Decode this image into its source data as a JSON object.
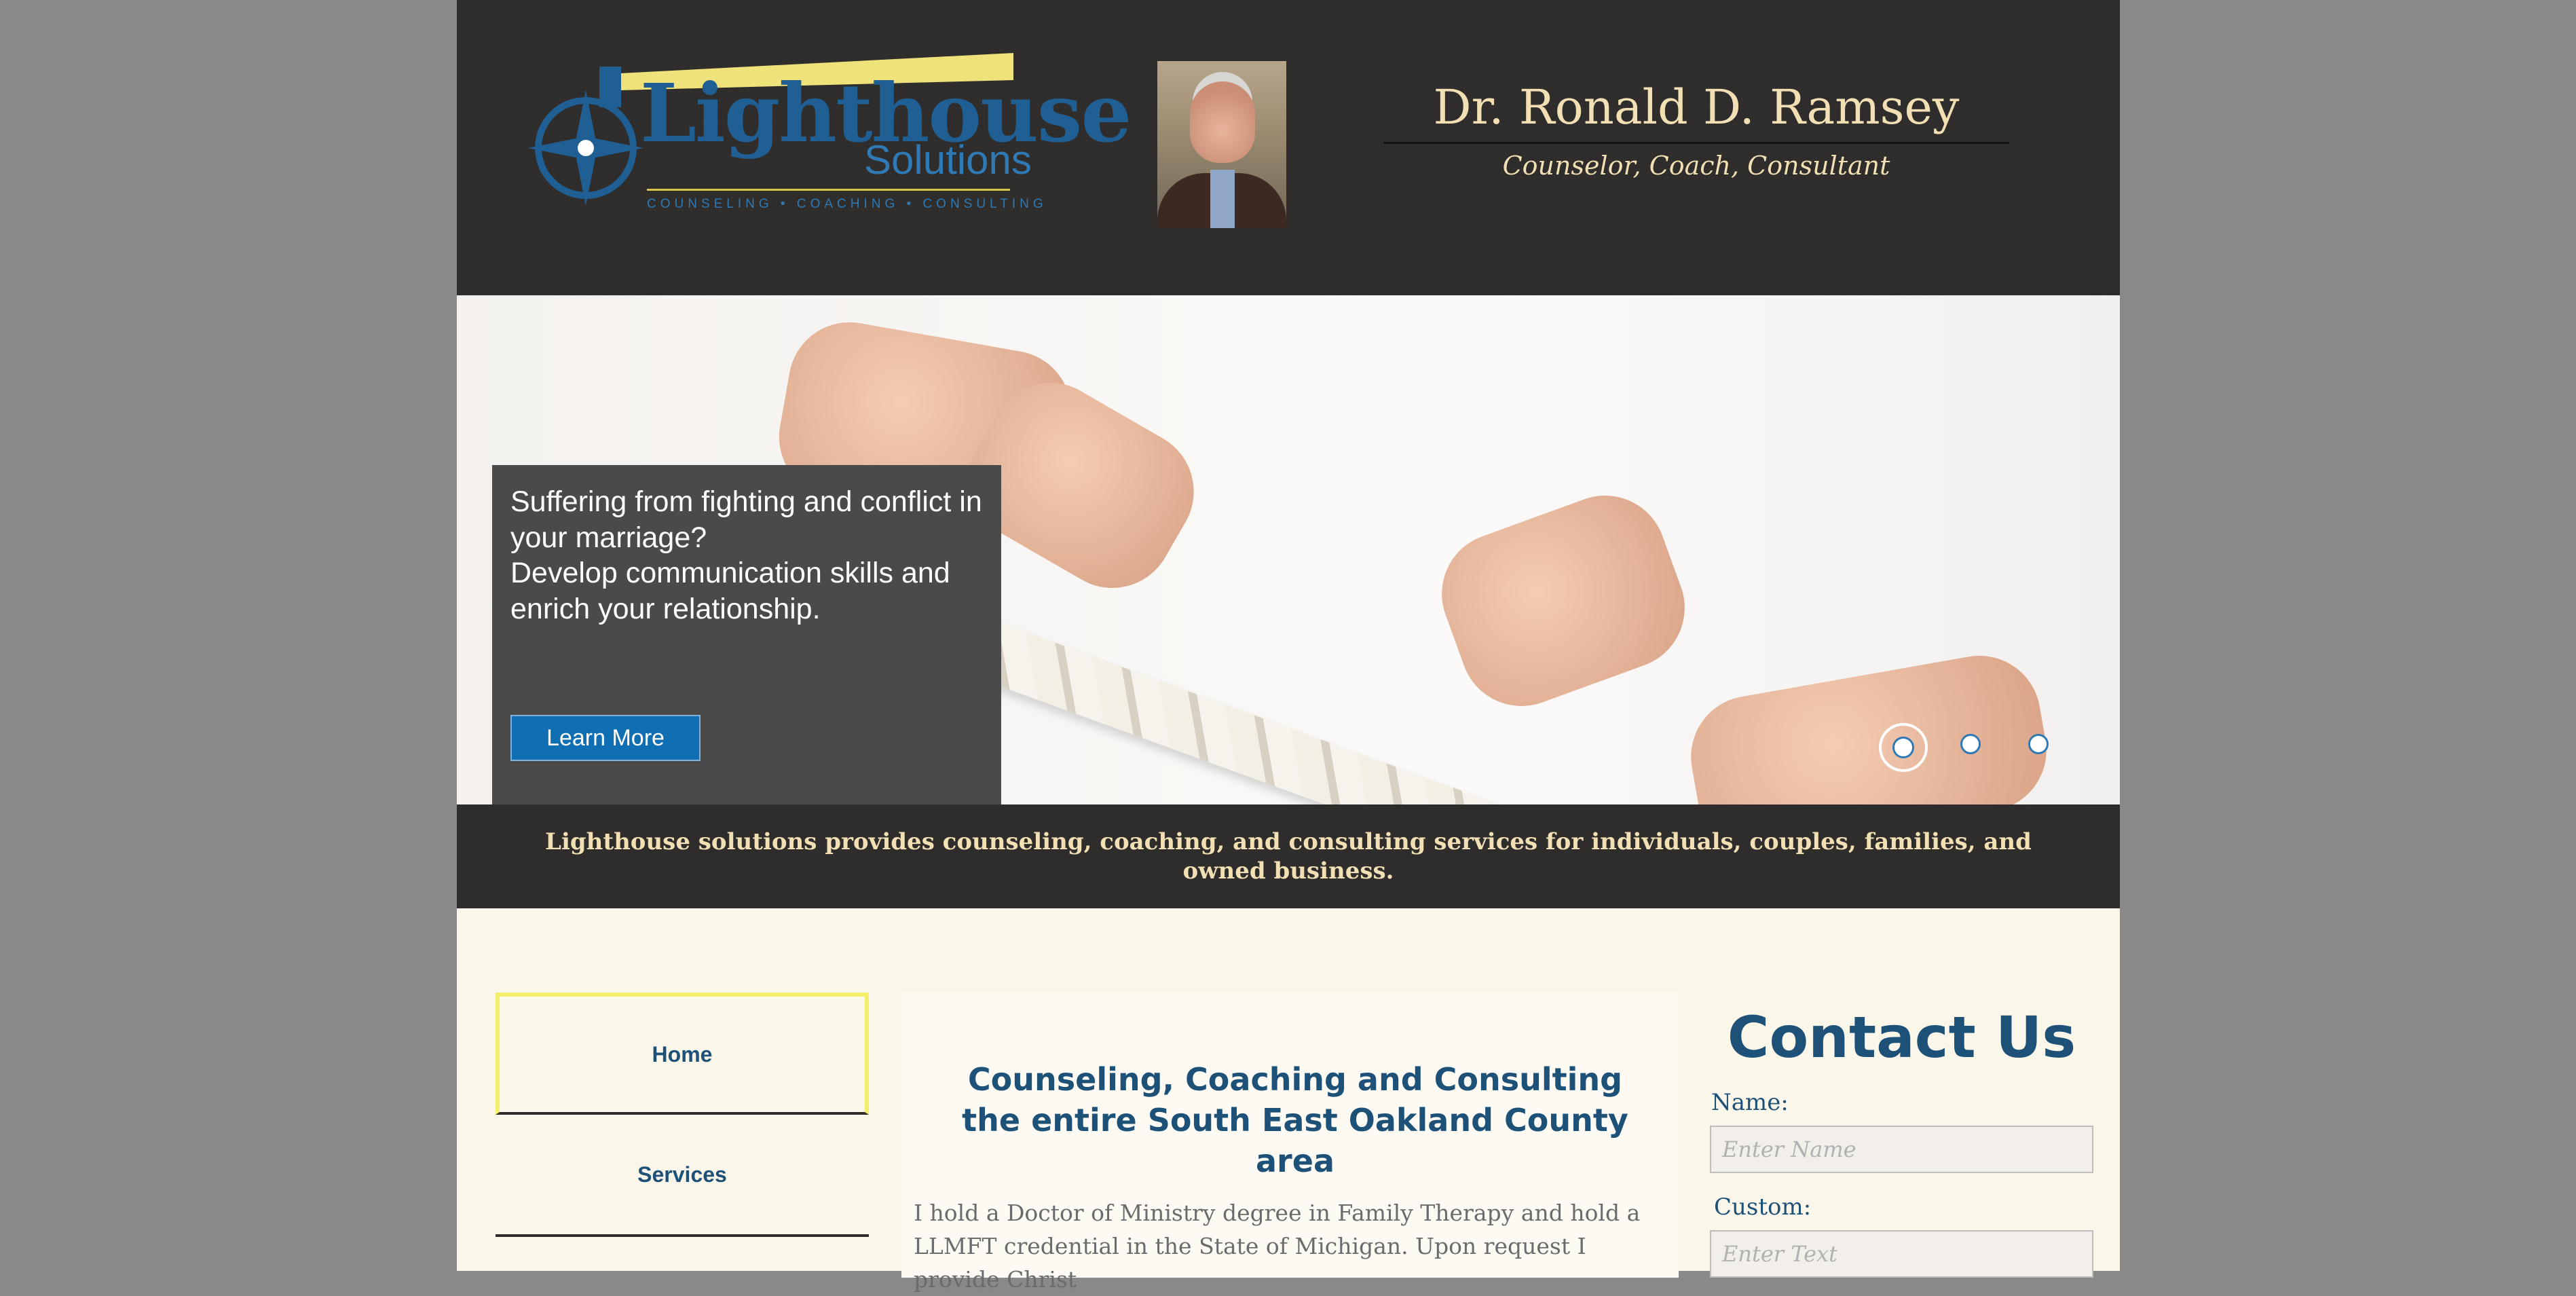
{
  "header": {
    "logo": {
      "word": "Lighthouse",
      "sub": "Solutions",
      "tagline": "COUNSELING • COACHING • CONSULTING"
    },
    "name": "Dr. Ronald D. Ramsey",
    "title": "Counselor, Coach, Consultant"
  },
  "hero": {
    "line1": "Suffering from fighting and conflict in your marriage?",
    "line2": "Develop communication skills and enrich your relationship.",
    "button": "Learn More",
    "slides": 3,
    "active_slide": 1
  },
  "tagline": "Lighthouse solutions provides counseling, coaching, and consulting services for individuals, couples, families, and owned business.",
  "nav": {
    "items": [
      {
        "label": "Home"
      },
      {
        "label": "Services"
      }
    ]
  },
  "main": {
    "title": "Counseling, Coaching and Consulting the entire South East Oakland County area",
    "text": "I hold a Doctor of Ministry degree in Family Therapy and hold a LLMFT credential in the State of Michigan.  Upon request I provide Christ"
  },
  "contact": {
    "title": "Contact Us",
    "name_label": "Name:",
    "name_placeholder": "Enter Name",
    "custom_label": "Custom:",
    "custom_placeholder": "Enter Text"
  },
  "colors": {
    "accent": "#1d5178",
    "header_bg": "#2e2d2c",
    "cream": "#f2dfb4",
    "button": "#0f6fb2"
  }
}
